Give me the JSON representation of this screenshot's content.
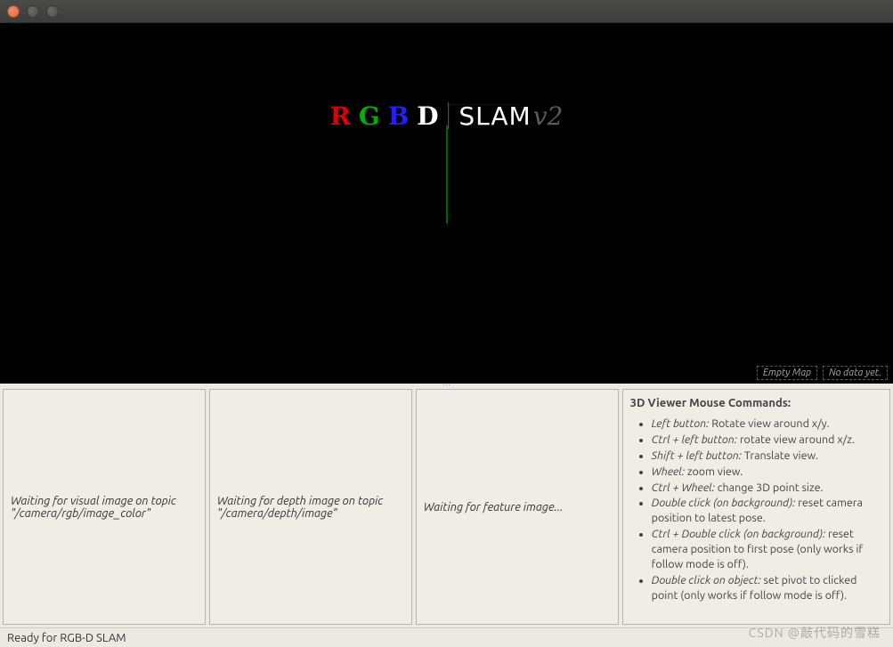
{
  "window": {
    "close": "close",
    "min": "minimize",
    "max": "maximize"
  },
  "viewer": {
    "logo_r": "R",
    "logo_g": "G",
    "logo_b": "B",
    "logo_d": "D",
    "logo_slam": "SLAM",
    "logo_v2": "v2",
    "overlay_map": "Empty Map",
    "overlay_data": "No data yet."
  },
  "panels": {
    "rgb_line1": "Waiting for visual image on topic",
    "rgb_line2": "\"/camera/rgb/image_color\"",
    "depth_line1": "Waiting for depth image on topic",
    "depth_line2": "\"/camera/depth/image\"",
    "feat": "Waiting for feature image...",
    "help_title": "3D Viewer Mouse Commands:",
    "help_items": [
      {
        "cmd": "Left button:",
        "desc": " Rotate view around x/y."
      },
      {
        "cmd": "Ctrl + left button:",
        "desc": " rotate view around x/z."
      },
      {
        "cmd": "Shift + left button:",
        "desc": " Translate view."
      },
      {
        "cmd": "Wheel:",
        "desc": " zoom view."
      },
      {
        "cmd": "Ctrl + Wheel:",
        "desc": " change 3D point size."
      },
      {
        "cmd": "Double click (on background):",
        "desc": " reset camera position to latest pose."
      },
      {
        "cmd": "Ctrl + Double click (on background):",
        "desc": " reset camera position to first pose (only works if follow mode is off)."
      },
      {
        "cmd": "Double click on object:",
        "desc": " set pivot to clicked point (only works if follow mode is off)."
      }
    ]
  },
  "status": "Ready for RGB-D SLAM",
  "watermark": "CSDN @敲代码的雪糕"
}
